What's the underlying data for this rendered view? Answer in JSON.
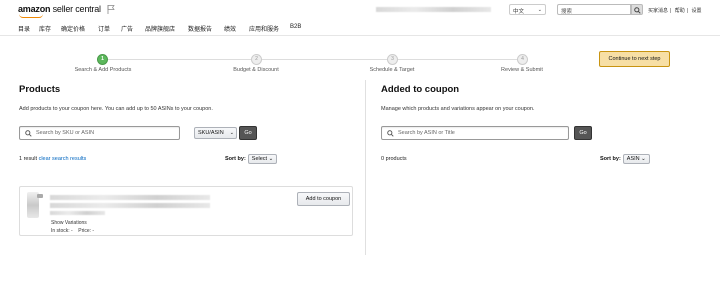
{
  "header": {
    "logo_bold": "amazon",
    "logo_rest": " seller central",
    "language": "中文",
    "search_placeholder": "搜索",
    "links": [
      "买家消息",
      "帮助",
      "设置"
    ]
  },
  "nav": [
    {
      "label": "目录"
    },
    {
      "label": "库存"
    },
    {
      "label": "确定价格"
    },
    {
      "label": "订单"
    },
    {
      "label": "广告"
    },
    {
      "label": "品牌旗舰店"
    },
    {
      "label": "数据报告"
    },
    {
      "label": "绩效"
    },
    {
      "label": "应用和服务"
    },
    {
      "label": "B2B"
    }
  ],
  "steps": [
    {
      "number": "1",
      "label": "Search & Add Products",
      "active": true
    },
    {
      "number": "2",
      "label": "Budget & Discount",
      "active": false
    },
    {
      "number": "3",
      "label": "Schedule & Target",
      "active": false
    },
    {
      "number": "4",
      "label": "Review & Submit",
      "active": false
    }
  ],
  "continue_label": "Continue to next step",
  "products_panel": {
    "title": "Products",
    "description": "Add products to your coupon here. You can add up to 50 ASINs to your coupon.",
    "search_placeholder": "Search by SKU or ASIN",
    "filter_value": "SKU/ASIN",
    "go_label": "Go",
    "result_count": "1 result",
    "clear_label": "clear search results",
    "sort_label": "Sort by:",
    "sort_value": "Select",
    "product": {
      "show_variations": "Show Variations",
      "stock_label": "In stock: -",
      "price_label": "Price: -",
      "add_label": "Add to coupon"
    }
  },
  "coupon_panel": {
    "title": "Added to coupon",
    "description": "Manage which products and variations appear on your coupon.",
    "search_placeholder": "Search by ASIN or Title",
    "go_label": "Go",
    "count": "0 products",
    "sort_label": "Sort by:",
    "sort_value": "ASIN"
  },
  "colors": {
    "active_step": "#5cb85c",
    "continue_button": "#f7dfa5",
    "link": "#0066c0",
    "go_button": "#555555"
  }
}
